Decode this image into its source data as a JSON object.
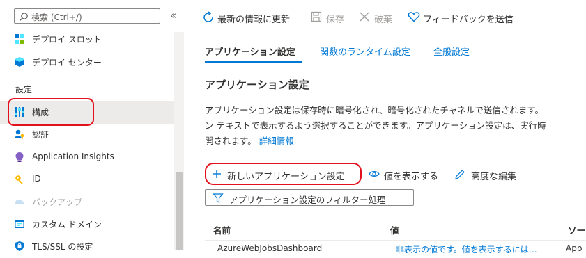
{
  "sidebar": {
    "search_placeholder": "検索 (Ctrl+/)",
    "collapse_glyph": "«",
    "items_top": [
      {
        "label": "デプロイ スロット",
        "icon": "deployment-slots-icon"
      },
      {
        "label": "デプロイ センター",
        "icon": "deployment-center-icon"
      }
    ],
    "section_label": "設定",
    "items": [
      {
        "label": "構成",
        "icon": "configuration-icon"
      },
      {
        "label": "認証",
        "icon": "authentication-icon"
      },
      {
        "label": "Application Insights",
        "icon": "application-insights-icon"
      },
      {
        "label": "ID",
        "icon": "identity-icon"
      },
      {
        "label": "バックアップ",
        "icon": "backup-icon"
      },
      {
        "label": "カスタム ドメイン",
        "icon": "custom-domain-icon"
      },
      {
        "label": "TLS/SSL の設定",
        "icon": "tls-ssl-icon"
      }
    ]
  },
  "toolbar": {
    "refresh_label": "最新の情報に更新",
    "save_label": "保存",
    "discard_label": "破棄",
    "feedback_label": "フィードバックを送信"
  },
  "tabs": [
    {
      "label": "アプリケーション設定"
    },
    {
      "label": "関数のランタイム設定"
    },
    {
      "label": "全般設定"
    }
  ],
  "main": {
    "heading": "アプリケーション設定",
    "desc_line1": "アプリケーション設定は保存時に暗号化され、暗号化されたチャネルで送信されます。",
    "desc_line2": "ン テキストで表示するよう選択することができます。アプリケーション設定は、実行時",
    "desc_line3": "開されます。",
    "learn_more": "詳細情報",
    "new_setting_label": "新しいアプリケーション設定",
    "show_values_label": "値を表示する",
    "advanced_edit_label": "高度な編集",
    "filter_label": "アプリケーション設定のフィルター処理"
  },
  "table": {
    "columns": [
      "名前",
      "値",
      "ソー"
    ],
    "rows": [
      {
        "name": "AzureWebJobsDashboard",
        "value": "非表示の値です。値を表示するには…",
        "source": "App"
      }
    ]
  },
  "colors": {
    "accent": "#0078d4",
    "highlight_outline": "#e3111d",
    "selected_bg": "#edebe9"
  }
}
